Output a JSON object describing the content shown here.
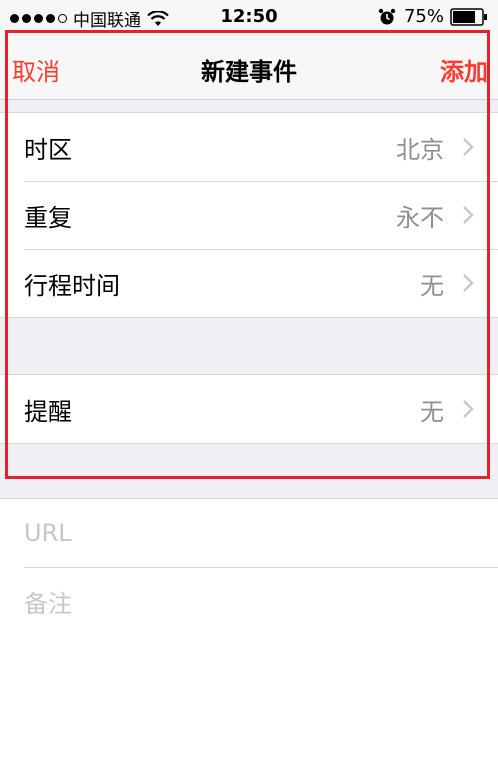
{
  "status_bar": {
    "carrier": "中国联通",
    "time": "12:50",
    "battery": "75%",
    "icons": [
      "signal-dots-icon",
      "wifi-icon",
      "alarm-icon",
      "battery-icon"
    ]
  },
  "nav": {
    "cancel": "取消",
    "title": "新建事件",
    "add": "添加"
  },
  "group1": [
    {
      "label": "时区",
      "value": "北京"
    },
    {
      "label": "重复",
      "value": "永不"
    },
    {
      "label": "行程时间",
      "value": "无"
    }
  ],
  "group2": [
    {
      "label": "提醒",
      "value": "无"
    }
  ],
  "fields": {
    "url_placeholder": "URL",
    "notes_placeholder": "备注"
  },
  "colors": {
    "accent": "#ff3b30",
    "highlight_frame": "#e8202a",
    "secondary_text": "#8e8e93",
    "placeholder": "#c7c7cd",
    "grouped_background": "#efeff4"
  }
}
